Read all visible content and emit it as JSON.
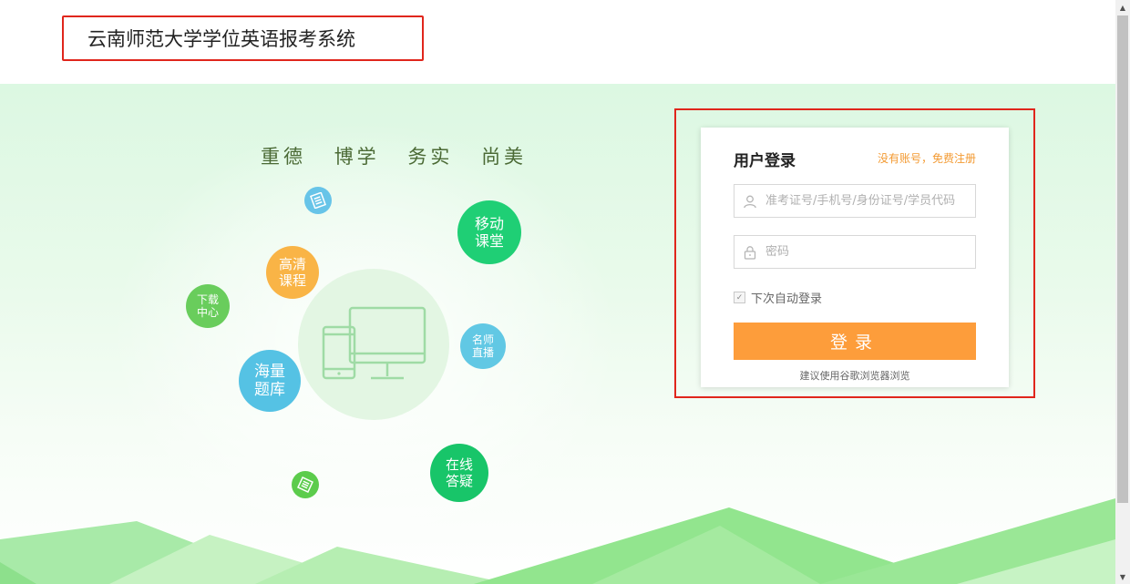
{
  "header": {
    "title": "云南师范大学学位英语报考系统"
  },
  "hero": {
    "motto": [
      "重德",
      "博学",
      "务实",
      "尚美"
    ],
    "bubbles": {
      "mobile_class": [
        "移动",
        "课堂"
      ],
      "hd_course": [
        "高清",
        "课程"
      ],
      "download_center": [
        "下载",
        "中心"
      ],
      "famous_teacher_live": [
        "名师",
        "直播"
      ],
      "question_bank": [
        "海量",
        "题库"
      ],
      "online_qa": [
        "在线",
        "答疑"
      ]
    },
    "icons": [
      "document-icon",
      "book-icon",
      "computer-phone-icon"
    ]
  },
  "login": {
    "title": "用户登录",
    "register_link": "没有账号，免费注册",
    "username_placeholder": "准考证号/手机号/身份证号/学员代码",
    "password_placeholder": "密码",
    "remember_label": "下次自动登录",
    "remember_checked": true,
    "submit_label": "登录",
    "browser_hint": "建议使用谷歌浏览器浏览"
  },
  "colors": {
    "accent_orange": "#fd9d3b",
    "link_orange": "#f39a32",
    "highlight_red": "#e0261c",
    "green": "#1fcf75"
  }
}
